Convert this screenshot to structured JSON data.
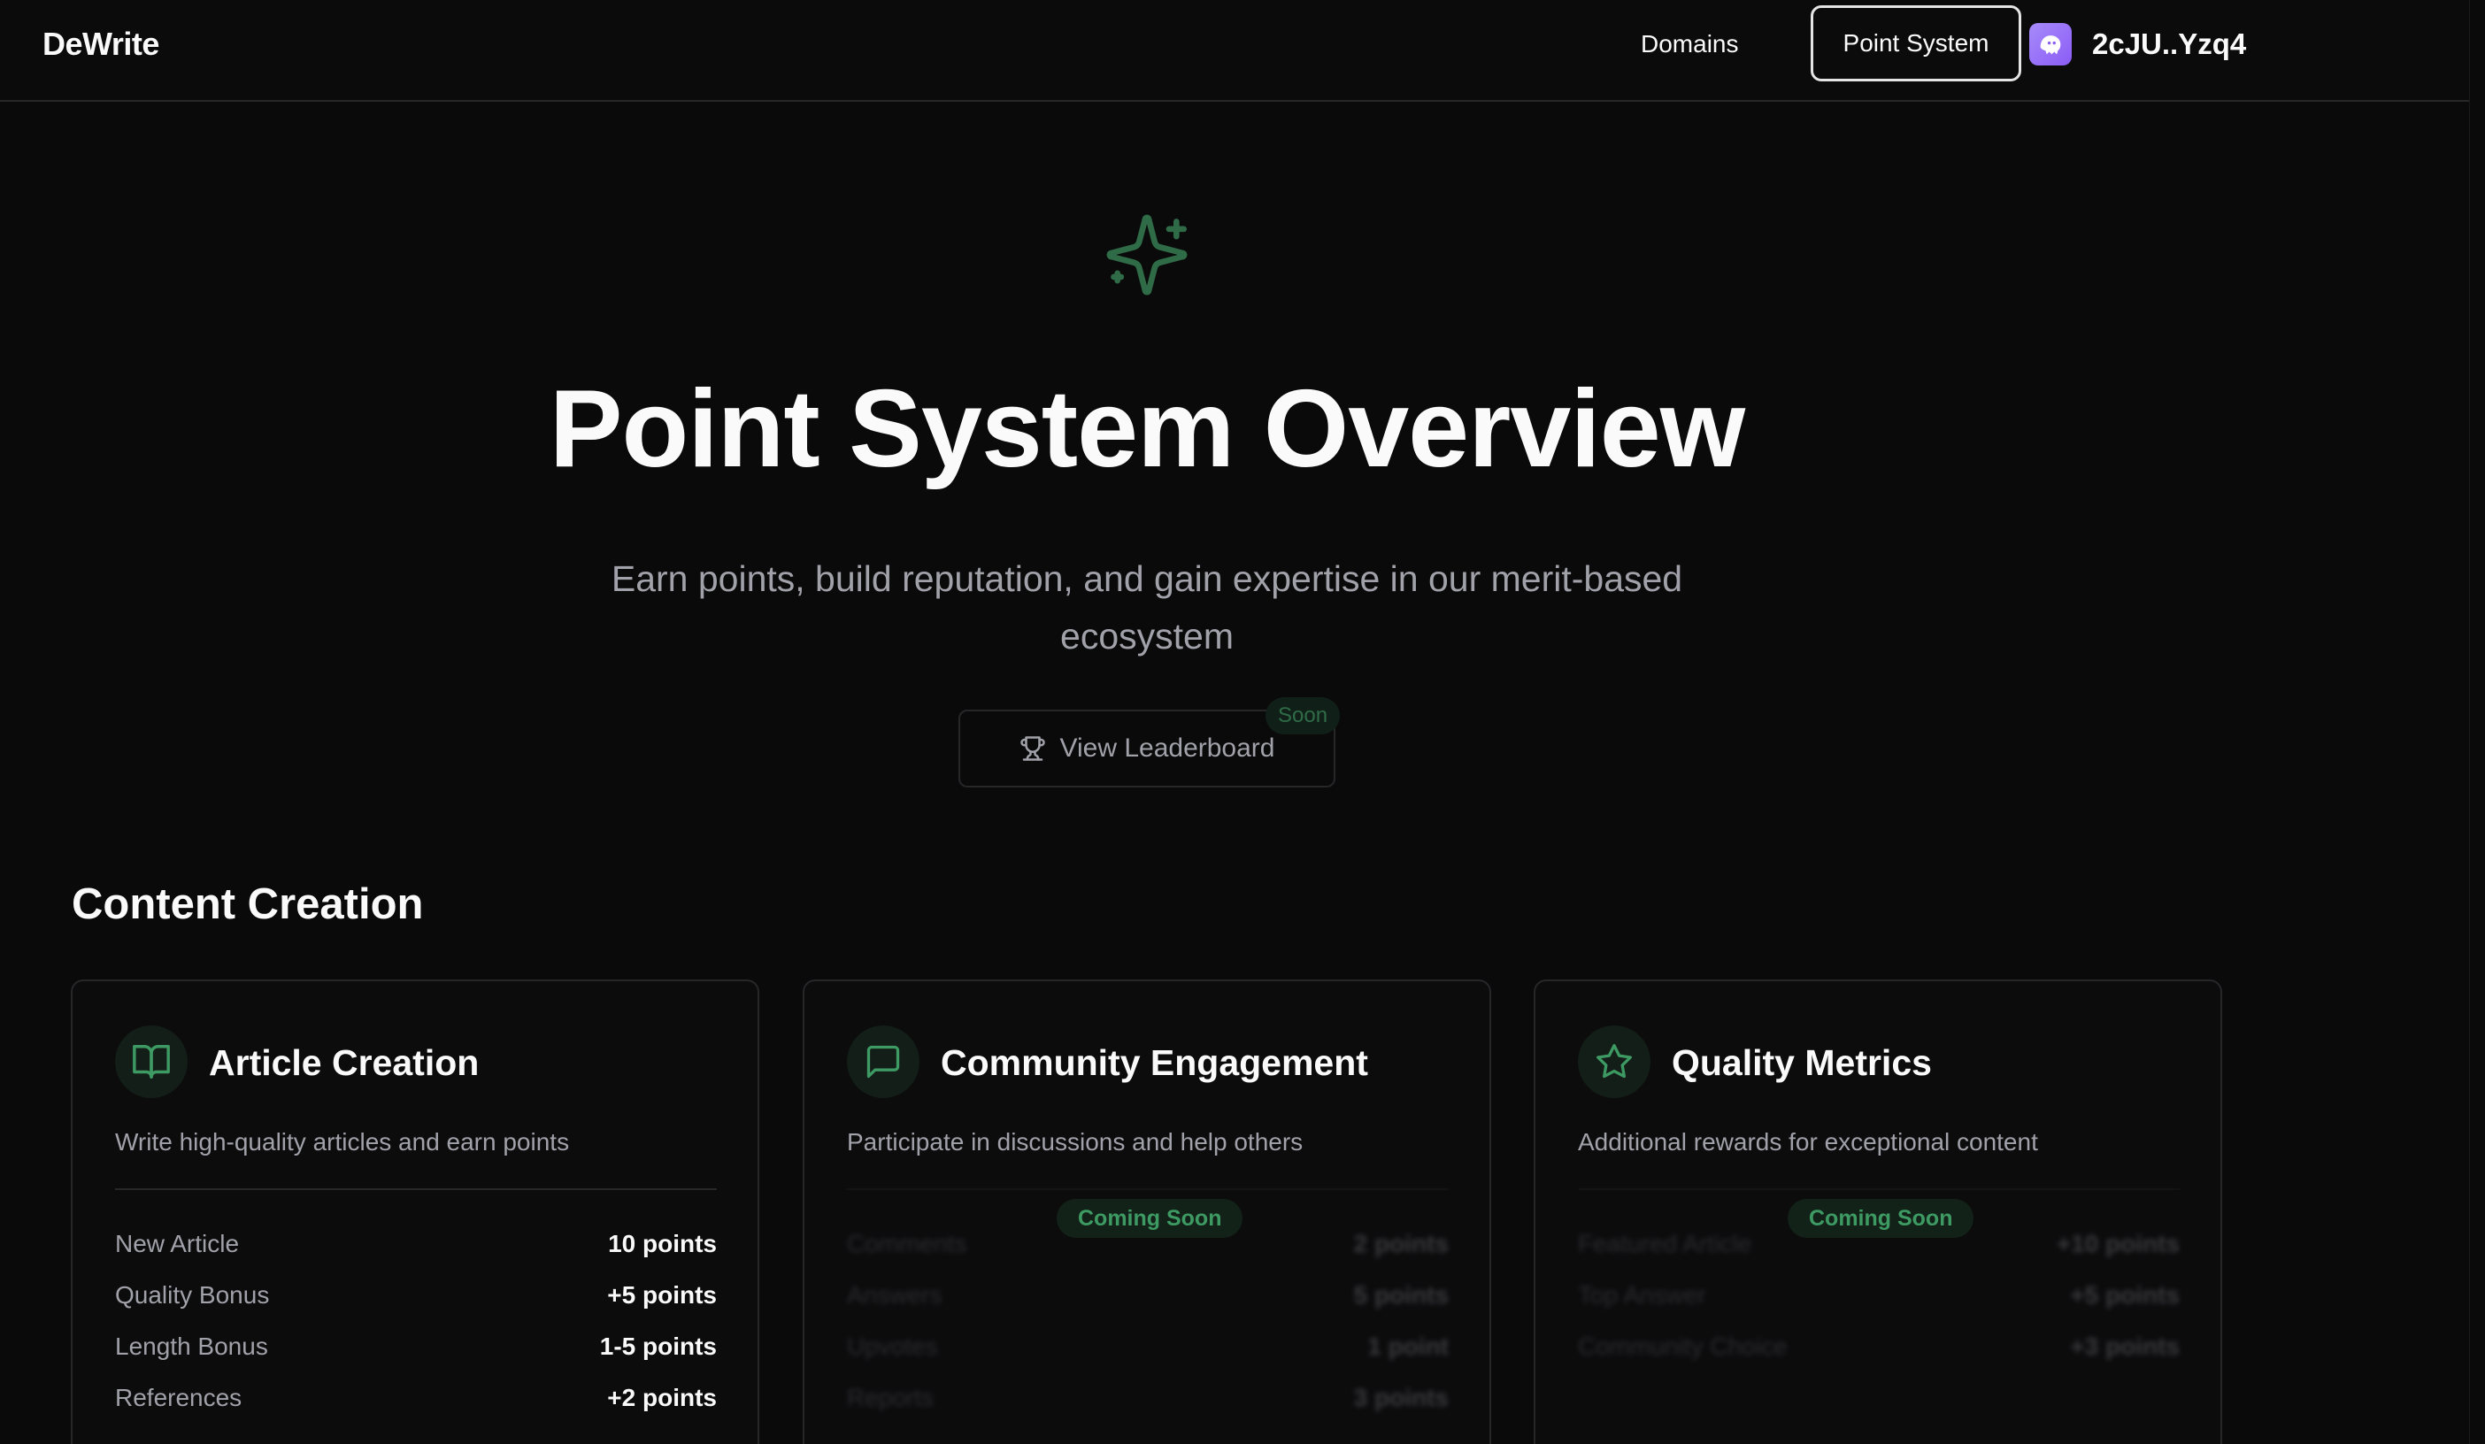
{
  "header": {
    "brand": "DeWrite",
    "nav": {
      "domains": "Domains",
      "point_system": "Point System"
    },
    "wallet": "2cJU..Yzq4",
    "avatar_icon": "ghost-icon"
  },
  "hero": {
    "icon": "sparkles-icon",
    "title": "Point System Overview",
    "subtitle": "Earn points, build reputation, and gain expertise in our merit-based ecosystem",
    "leaderboard_button": "View Leaderboard",
    "leaderboard_icon": "trophy-icon",
    "leaderboard_badge": "Soon"
  },
  "section": {
    "title": "Content Creation"
  },
  "cards": [
    {
      "icon": "book-open-icon",
      "title": "Article Creation",
      "description": "Write high-quality articles and earn points",
      "rows": [
        {
          "label": "New Article",
          "value": "10 points"
        },
        {
          "label": "Quality Bonus",
          "value": "+5 points"
        },
        {
          "label": "Length Bonus",
          "value": "1-5 points"
        },
        {
          "label": "References",
          "value": "+2 points"
        }
      ]
    },
    {
      "icon": "message-square-icon",
      "title": "Community Engagement",
      "description": "Participate in discussions and help others",
      "badge": "Coming Soon",
      "rows": [
        {
          "label": "Comments",
          "value": "2 points"
        },
        {
          "label": "Answers",
          "value": "5 points"
        },
        {
          "label": "Upvotes",
          "value": "1 point"
        },
        {
          "label": "Reports",
          "value": "3 points"
        }
      ]
    },
    {
      "icon": "star-icon",
      "title": "Quality Metrics",
      "description": "Additional rewards for exceptional content",
      "badge": "Coming Soon",
      "rows": [
        {
          "label": "Featured Article",
          "value": "+10 points"
        },
        {
          "label": "Top Answer",
          "value": "+5 points"
        },
        {
          "label": "Community Choice",
          "value": "+3 points"
        }
      ]
    }
  ],
  "colors": {
    "background": "#0a0a0b",
    "accent_green": "#2f6b47",
    "badge_green": "#3e9a63",
    "avatar_purple": "#8b5cf6"
  }
}
